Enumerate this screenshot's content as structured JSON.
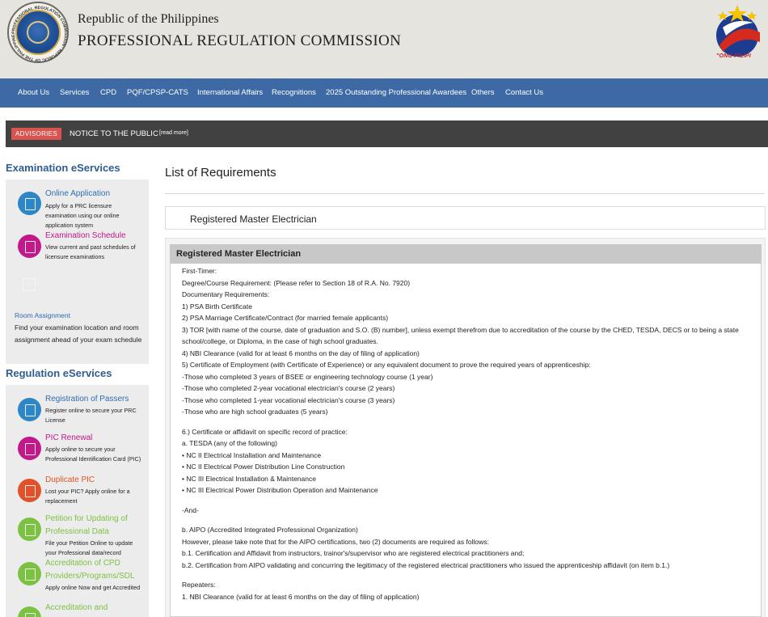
{
  "header": {
    "line1": "Republic of the Philippines",
    "line2": "PROFESSIONAL REGULATION COMMISSION",
    "seal_ring_text": "PROFESSIONAL REGULATION COMMISSION · REPUBLIC OF THE PHILIPPINES ·",
    "bp_text": "\"ONG PILIPI"
  },
  "nav": {
    "items": [
      "About Us",
      "Services",
      "CPD",
      "PQF/CPSP-CATS",
      "International Affairs",
      "Recognitions",
      "2025 Outstanding Professional Awardees",
      "Others",
      "Contact Us"
    ]
  },
  "advisory": {
    "badge": "ADVISORIES",
    "text": "NOTICE TO THE PUBLIC",
    "more": "[read more]"
  },
  "sidebar": {
    "exam_title": "Examination eServices",
    "exam_services": [
      {
        "title": "Online Application",
        "desc": "Apply for a PRC licensure examination using our online application system"
      },
      {
        "title": "Examination Schedule",
        "desc": "View current and past schedules of licensure examinations"
      }
    ],
    "room_title": "Room Assignment",
    "room_desc": "Find your examination location and room assignment ahead of your exam schedule",
    "reg_title": "Regulation eServices",
    "reg_services": [
      {
        "title": "Registration of Passers",
        "desc": "Register online to secure your PRC License"
      },
      {
        "title": "PIC Renewal",
        "desc": "Apply online to secure your Professional Identification Card (PIC)"
      },
      {
        "title": "Duplicate PIC",
        "desc": "Lost your PIC? Apply online for a replacement"
      },
      {
        "title": "Petition for Updating of Professional Data",
        "desc": "File your Petition Online to update your Professional data/record"
      },
      {
        "title": "Accreditation of CPD Providers/Programs/SDL",
        "desc": "Apply online Now and get Accredited"
      },
      {
        "title": "Accreditation and",
        "desc": ""
      }
    ]
  },
  "colors": {
    "nav_bg": "#3d6aa4",
    "link_blue": "#2f6db0",
    "link_magenta": "#c1188a",
    "link_orange": "#e2522a",
    "link_green": "#7cc242",
    "advisory_badge": "#d9534f"
  },
  "main": {
    "title": "List of Requirements",
    "accordion_label": "Registered Master Electrician",
    "panel_title": "Registered Master Electrician",
    "lines": [
      "First-Timer:",
      "Degree/Course Requirement: (Please refer to Section 18 of R.A. No. 7920)",
      "Documentary Requirements:",
      "1) PSA Birth Certificate",
      "2) PSA Marriage Certificate/Contract (for married female applicants)",
      "3) TOR [with name of the course, date of graduation and S.O. (B) number], unless exempt therefrom due to accreditation of the course by the CHED, TESDA, DECS or to being a state school/college, or Diploma, in the case of high school graduates.",
      "4) NBI Clearance (valid for at least 6 months on the day of filing of application)",
      "5) Certificate of Employment (with Certificate of Experience) or any equivalent document to prove the required years of apprenticeship:",
      "-Those who completed 3 years of BSEE or engineering technology course (1 year)",
      "-Those who completed 2-year vocational electrician's course (2 years)",
      "-Those who completed 1-year vocational electrician's course (3 years)",
      "-Those who are high school graduates (5 years)",
      "",
      "6.) Certificate or affidavit on specific record of practice:",
      "a. TESDA (any of the following)",
      "• NC II Electrical Installation and Maintenance",
      "• NC II Electrical Power Distribution Line Construction",
      "• NC III Electrical Installation & Maintenance",
      "• NC III Electrical Power Distribution Operation and Maintenance",
      "",
      "-And-",
      "",
      "b. AIPO (Accredited Integrated Professional Organization)",
      "However, please take note that for the AIPO certifications, two (2) documents are required as follows:",
      "b.1. Certification and Affidavit from instructors, trainor's/supervisor who are registered electrical practitioners and;",
      "b.2. Certification from AIPO validating and concurring the legitimacy of the registered electrical practitioners who issued the apprenticeship affidavit (on item b.1.)",
      "",
      "Repeaters:",
      "1. NBI Clearance (valid for at least 6 months on the day of filing of application)"
    ]
  }
}
